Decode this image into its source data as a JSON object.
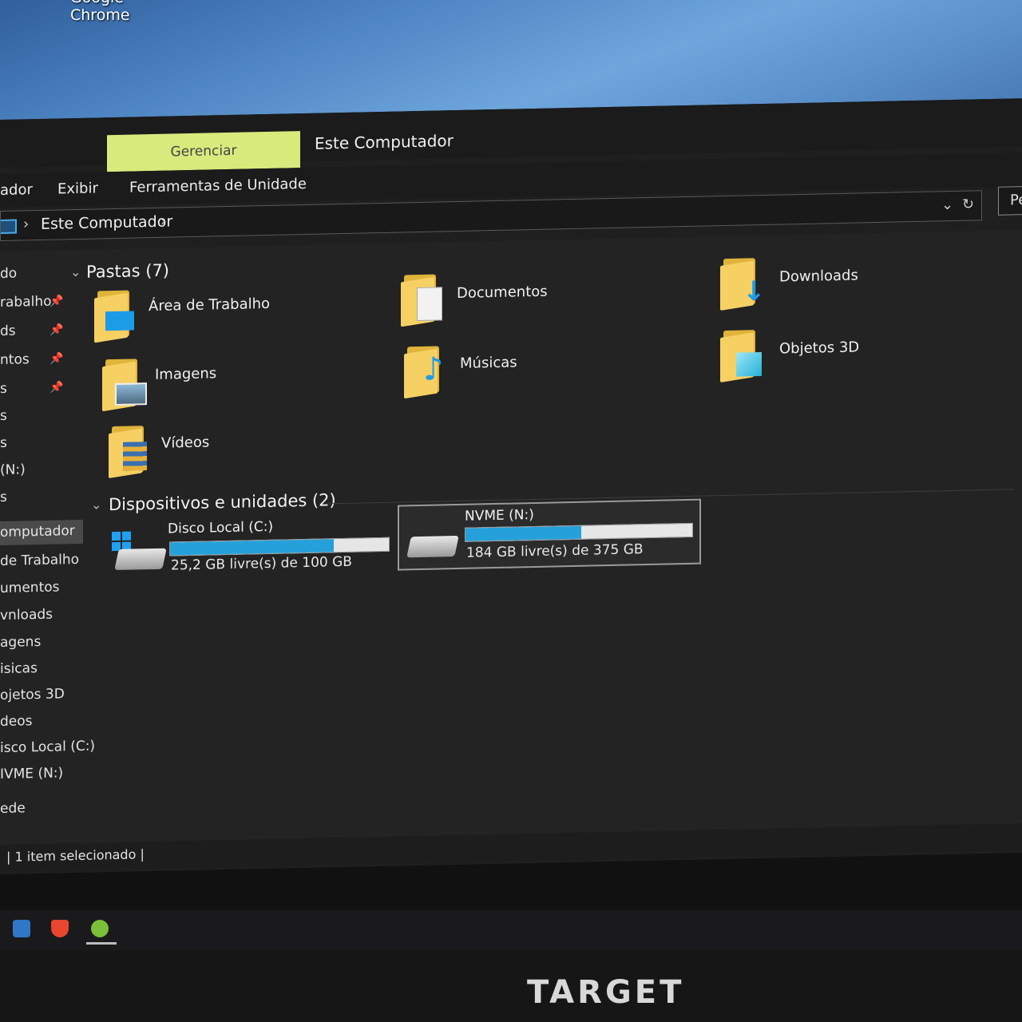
{
  "desktop": {
    "icon_label_top": "Google",
    "icon_label": "Chrome"
  },
  "window": {
    "title": "Este Computador",
    "manage_tab": "Gerenciar",
    "ribbon_tabs": [
      "ador",
      "Exibir",
      "Ferramentas de Unidade"
    ],
    "address": {
      "crumb": "Este Computador"
    },
    "search_placeholder": "Pe"
  },
  "navpane": {
    "items": [
      {
        "label": "do",
        "pinned": false
      },
      {
        "label": "rabalho",
        "pinned": true
      },
      {
        "label": "ds",
        "pinned": true
      },
      {
        "label": "ntos",
        "pinned": true
      },
      {
        "label": "s",
        "pinned": true
      },
      {
        "label": "s",
        "pinned": false
      },
      {
        "label": "s",
        "pinned": false
      },
      {
        "label": "(N:)",
        "pinned": false
      },
      {
        "label": "s",
        "pinned": false
      },
      {
        "label": "omputador",
        "pinned": false,
        "selected": true
      },
      {
        "label": "de Trabalho",
        "pinned": false
      },
      {
        "label": "umentos",
        "pinned": false
      },
      {
        "label": "vnloads",
        "pinned": false
      },
      {
        "label": "agens",
        "pinned": false
      },
      {
        "label": "isicas",
        "pinned": false
      },
      {
        "label": "ojetos 3D",
        "pinned": false
      },
      {
        "label": "deos",
        "pinned": false
      },
      {
        "label": "isco Local (C:)",
        "pinned": false
      },
      {
        "label": "IVME (N:)",
        "pinned": false
      },
      {
        "label": "ede",
        "pinned": false
      }
    ]
  },
  "folders": {
    "header": "Pastas (7)",
    "items": [
      {
        "label": "Área de Trabalho",
        "icon": "desktop-folder-icon"
      },
      {
        "label": "Documentos",
        "icon": "documents-folder-icon"
      },
      {
        "label": "Downloads",
        "icon": "downloads-folder-icon"
      },
      {
        "label": "Imagens",
        "icon": "pictures-folder-icon"
      },
      {
        "label": "Músicas",
        "icon": "music-folder-icon"
      },
      {
        "label": "Objetos 3D",
        "icon": "3d-objects-folder-icon"
      },
      {
        "label": "Vídeos",
        "icon": "videos-folder-icon"
      }
    ]
  },
  "devices": {
    "header": "Dispositivos e unidades (2)",
    "items": [
      {
        "name": "Disco Local (C:)",
        "free": "25,2 GB livre(s) de 100 GB",
        "used_fraction": 0.748,
        "selected": false
      },
      {
        "name": "NVME (N:)",
        "free": "184 GB livre(s) de 375 GB",
        "used_fraction": 0.509,
        "selected": true
      }
    ]
  },
  "status": {
    "text": "1 item selecionado"
  },
  "monitor": {
    "brand": "TARGET"
  },
  "colors": {
    "accent": "#26a0da",
    "manage_tab": "#d8ea7c",
    "folder": "#f6d063"
  }
}
